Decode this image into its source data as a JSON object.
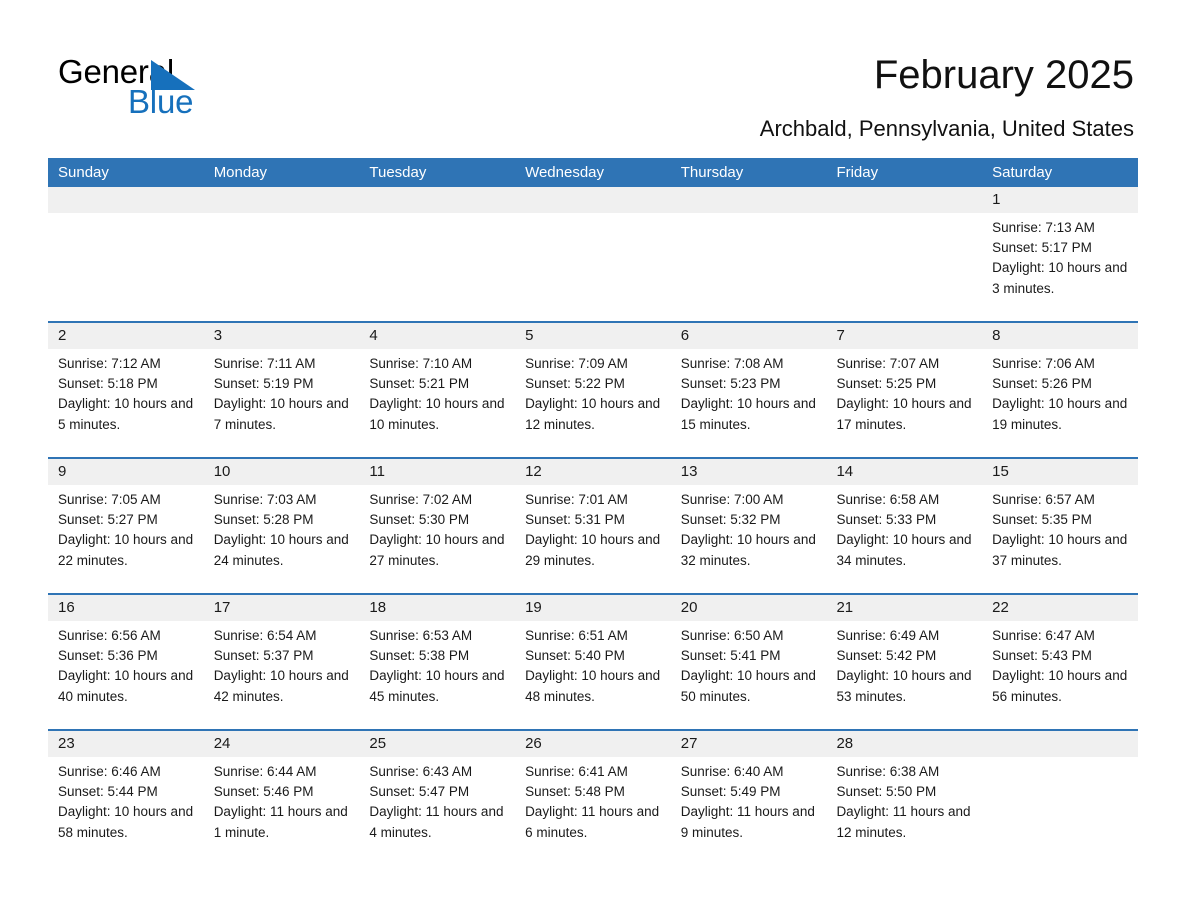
{
  "brand": {
    "name_part1": "General",
    "name_part2": "Blue",
    "triangle_color": "#1670bc",
    "text_color": "#000000"
  },
  "header": {
    "title": "February 2025",
    "subtitle": "Archbald, Pennsylvania, United States"
  },
  "theme": {
    "header_blue": "#2f74b5",
    "day_band_gray": "#f0f0f0",
    "text": "#1a1a1a"
  },
  "weekdays": [
    "Sunday",
    "Monday",
    "Tuesday",
    "Wednesday",
    "Thursday",
    "Friday",
    "Saturday"
  ],
  "weeks": [
    [
      {
        "day": "",
        "sunrise": "",
        "sunset": "",
        "daylight": ""
      },
      {
        "day": "",
        "sunrise": "",
        "sunset": "",
        "daylight": ""
      },
      {
        "day": "",
        "sunrise": "",
        "sunset": "",
        "daylight": ""
      },
      {
        "day": "",
        "sunrise": "",
        "sunset": "",
        "daylight": ""
      },
      {
        "day": "",
        "sunrise": "",
        "sunset": "",
        "daylight": ""
      },
      {
        "day": "",
        "sunrise": "",
        "sunset": "",
        "daylight": ""
      },
      {
        "day": "1",
        "sunrise": "Sunrise: 7:13 AM",
        "sunset": "Sunset: 5:17 PM",
        "daylight": "Daylight: 10 hours and 3 minutes."
      }
    ],
    [
      {
        "day": "2",
        "sunrise": "Sunrise: 7:12 AM",
        "sunset": "Sunset: 5:18 PM",
        "daylight": "Daylight: 10 hours and 5 minutes."
      },
      {
        "day": "3",
        "sunrise": "Sunrise: 7:11 AM",
        "sunset": "Sunset: 5:19 PM",
        "daylight": "Daylight: 10 hours and 7 minutes."
      },
      {
        "day": "4",
        "sunrise": "Sunrise: 7:10 AM",
        "sunset": "Sunset: 5:21 PM",
        "daylight": "Daylight: 10 hours and 10 minutes."
      },
      {
        "day": "5",
        "sunrise": "Sunrise: 7:09 AM",
        "sunset": "Sunset: 5:22 PM",
        "daylight": "Daylight: 10 hours and 12 minutes."
      },
      {
        "day": "6",
        "sunrise": "Sunrise: 7:08 AM",
        "sunset": "Sunset: 5:23 PM",
        "daylight": "Daylight: 10 hours and 15 minutes."
      },
      {
        "day": "7",
        "sunrise": "Sunrise: 7:07 AM",
        "sunset": "Sunset: 5:25 PM",
        "daylight": "Daylight: 10 hours and 17 minutes."
      },
      {
        "day": "8",
        "sunrise": "Sunrise: 7:06 AM",
        "sunset": "Sunset: 5:26 PM",
        "daylight": "Daylight: 10 hours and 19 minutes."
      }
    ],
    [
      {
        "day": "9",
        "sunrise": "Sunrise: 7:05 AM",
        "sunset": "Sunset: 5:27 PM",
        "daylight": "Daylight: 10 hours and 22 minutes."
      },
      {
        "day": "10",
        "sunrise": "Sunrise: 7:03 AM",
        "sunset": "Sunset: 5:28 PM",
        "daylight": "Daylight: 10 hours and 24 minutes."
      },
      {
        "day": "11",
        "sunrise": "Sunrise: 7:02 AM",
        "sunset": "Sunset: 5:30 PM",
        "daylight": "Daylight: 10 hours and 27 minutes."
      },
      {
        "day": "12",
        "sunrise": "Sunrise: 7:01 AM",
        "sunset": "Sunset: 5:31 PM",
        "daylight": "Daylight: 10 hours and 29 minutes."
      },
      {
        "day": "13",
        "sunrise": "Sunrise: 7:00 AM",
        "sunset": "Sunset: 5:32 PM",
        "daylight": "Daylight: 10 hours and 32 minutes."
      },
      {
        "day": "14",
        "sunrise": "Sunrise: 6:58 AM",
        "sunset": "Sunset: 5:33 PM",
        "daylight": "Daylight: 10 hours and 34 minutes."
      },
      {
        "day": "15",
        "sunrise": "Sunrise: 6:57 AM",
        "sunset": "Sunset: 5:35 PM",
        "daylight": "Daylight: 10 hours and 37 minutes."
      }
    ],
    [
      {
        "day": "16",
        "sunrise": "Sunrise: 6:56 AM",
        "sunset": "Sunset: 5:36 PM",
        "daylight": "Daylight: 10 hours and 40 minutes."
      },
      {
        "day": "17",
        "sunrise": "Sunrise: 6:54 AM",
        "sunset": "Sunset: 5:37 PM",
        "daylight": "Daylight: 10 hours and 42 minutes."
      },
      {
        "day": "18",
        "sunrise": "Sunrise: 6:53 AM",
        "sunset": "Sunset: 5:38 PM",
        "daylight": "Daylight: 10 hours and 45 minutes."
      },
      {
        "day": "19",
        "sunrise": "Sunrise: 6:51 AM",
        "sunset": "Sunset: 5:40 PM",
        "daylight": "Daylight: 10 hours and 48 minutes."
      },
      {
        "day": "20",
        "sunrise": "Sunrise: 6:50 AM",
        "sunset": "Sunset: 5:41 PM",
        "daylight": "Daylight: 10 hours and 50 minutes."
      },
      {
        "day": "21",
        "sunrise": "Sunrise: 6:49 AM",
        "sunset": "Sunset: 5:42 PM",
        "daylight": "Daylight: 10 hours and 53 minutes."
      },
      {
        "day": "22",
        "sunrise": "Sunrise: 6:47 AM",
        "sunset": "Sunset: 5:43 PM",
        "daylight": "Daylight: 10 hours and 56 minutes."
      }
    ],
    [
      {
        "day": "23",
        "sunrise": "Sunrise: 6:46 AM",
        "sunset": "Sunset: 5:44 PM",
        "daylight": "Daylight: 10 hours and 58 minutes."
      },
      {
        "day": "24",
        "sunrise": "Sunrise: 6:44 AM",
        "sunset": "Sunset: 5:46 PM",
        "daylight": "Daylight: 11 hours and 1 minute."
      },
      {
        "day": "25",
        "sunrise": "Sunrise: 6:43 AM",
        "sunset": "Sunset: 5:47 PM",
        "daylight": "Daylight: 11 hours and 4 minutes."
      },
      {
        "day": "26",
        "sunrise": "Sunrise: 6:41 AM",
        "sunset": "Sunset: 5:48 PM",
        "daylight": "Daylight: 11 hours and 6 minutes."
      },
      {
        "day": "27",
        "sunrise": "Sunrise: 6:40 AM",
        "sunset": "Sunset: 5:49 PM",
        "daylight": "Daylight: 11 hours and 9 minutes."
      },
      {
        "day": "28",
        "sunrise": "Sunrise: 6:38 AM",
        "sunset": "Sunset: 5:50 PM",
        "daylight": "Daylight: 11 hours and 12 minutes."
      },
      {
        "day": "",
        "sunrise": "",
        "sunset": "",
        "daylight": ""
      }
    ]
  ]
}
